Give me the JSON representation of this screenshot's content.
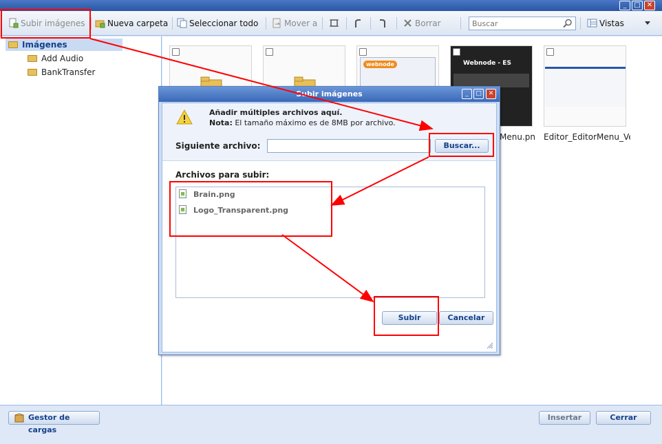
{
  "window": {
    "minimize": "_",
    "maximize": "□",
    "close": "✕"
  },
  "toolbar": {
    "upload_label": "Subir imágenes",
    "new_folder_label": "Nueva carpeta",
    "select_all_label": "Seleccionar todo",
    "move_to_label": "Mover a",
    "delete_label": "Borrar",
    "search_placeholder": "Buscar",
    "views_label": "Vistas"
  },
  "tree": {
    "root_label": "Imágenes",
    "items": [
      {
        "label": "Add Audio"
      },
      {
        "label": "BankTransfer"
      }
    ]
  },
  "thumbnails": {
    "thumb3_brand": "webnode",
    "thumb4_heading": "Webnode - ES",
    "thumb4_caption": "Menu.pn",
    "thumb5_caption": "Editor_EditorMenu_Ve"
  },
  "footer": {
    "upload_manager_label": "Gestor de cargas",
    "insert_label": "Insertar",
    "close_label": "Cerrar"
  },
  "dialog": {
    "title": "Subir imágenes",
    "add_title": "Añadir múltiples archivos aquí.",
    "note_bold": "Nota:",
    "note_text": " El tamaño máximo es de 8MB por archivo.",
    "next_file_label": "Siguiente archivo:",
    "browse_label": "Buscar...",
    "files_label": "Archivos para subir:",
    "files": [
      {
        "name": "Brain.png"
      },
      {
        "name": "Logo_Transparent.png"
      }
    ],
    "submit_label": "Subir",
    "cancel_label": "Cancelar"
  },
  "colors": {
    "annotation_red": "#ff0000",
    "title_blue": "#3a68b8",
    "button_text": "#15428b"
  }
}
